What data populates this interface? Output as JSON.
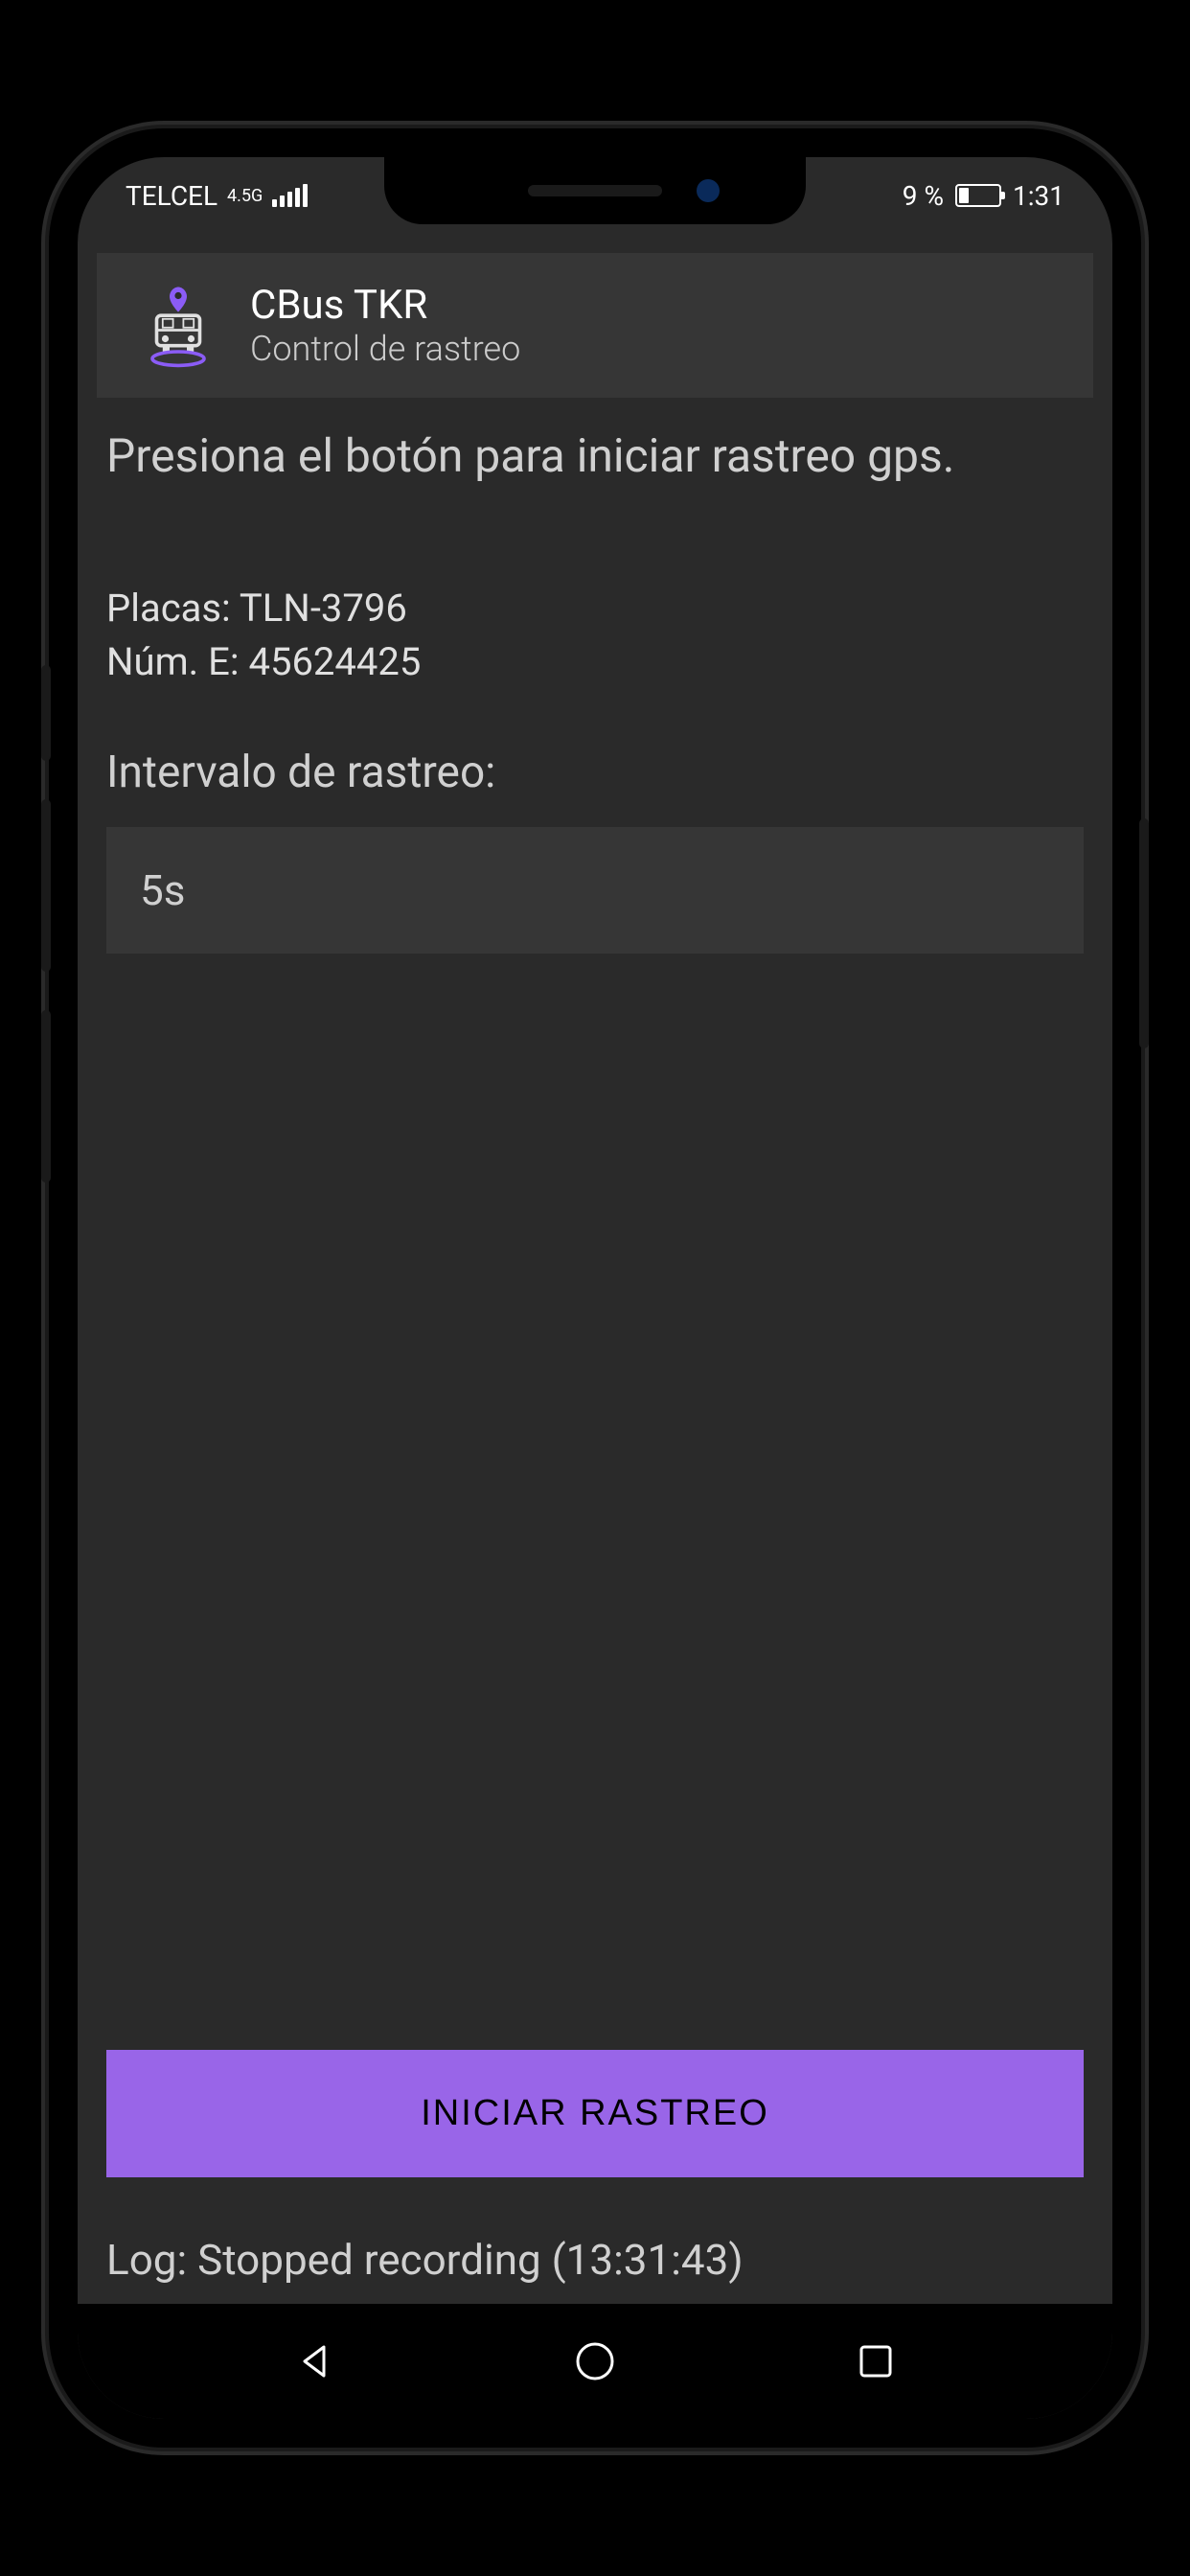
{
  "status_bar": {
    "carrier": "TELCEL",
    "network": "4.5G",
    "battery_percent": "9 %",
    "time": "1:31"
  },
  "header": {
    "title": "CBus TKR",
    "subtitle": "Control de rastreo"
  },
  "main": {
    "instruction": "Presiona el botón para iniciar rastreo gps.",
    "plates_label": "Placas:",
    "plates_value": "TLN-3796",
    "num_label": "Núm. E:",
    "num_value": "45624425",
    "interval_label": "Intervalo de rastreo:",
    "interval_value": "5s",
    "button_label": "INICIAR RASTREO",
    "log_text": "Log: Stopped recording (13:31:43)"
  },
  "colors": {
    "accent": "#9965e8",
    "background": "#2a2a2a",
    "surface": "#363636"
  }
}
